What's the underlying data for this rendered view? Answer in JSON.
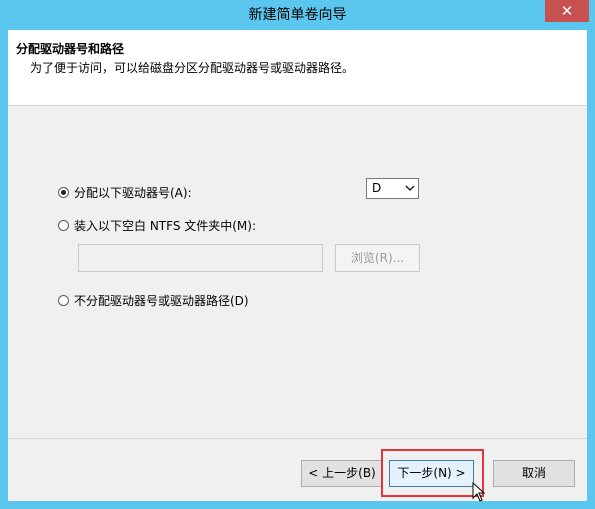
{
  "window": {
    "title": "新建简单卷向导",
    "close_label": "✕"
  },
  "header": {
    "title": "分配驱动器号和路径",
    "description": "为了便于访问，可以给磁盘分区分配驱动器号或驱动器路径。"
  },
  "options": {
    "assign_letter": {
      "label": "分配以下驱动器号(A):",
      "checked": true
    },
    "mount_folder": {
      "label": "装入以下空白 NTFS 文件夹中(M):",
      "checked": false
    },
    "no_assign": {
      "label": "不分配驱动器号或驱动器路径(D)",
      "checked": false
    }
  },
  "drive_select": {
    "value": "D"
  },
  "folder_path": {
    "value": "",
    "browse_label": "浏览(R)..."
  },
  "footer": {
    "back_label": "< 上一步(B)",
    "next_label": "下一步(N) >",
    "cancel_label": "取消"
  },
  "colors": {
    "frame": "#5bc7ef",
    "close_button": "#c75050",
    "highlight": "#e8323c"
  }
}
